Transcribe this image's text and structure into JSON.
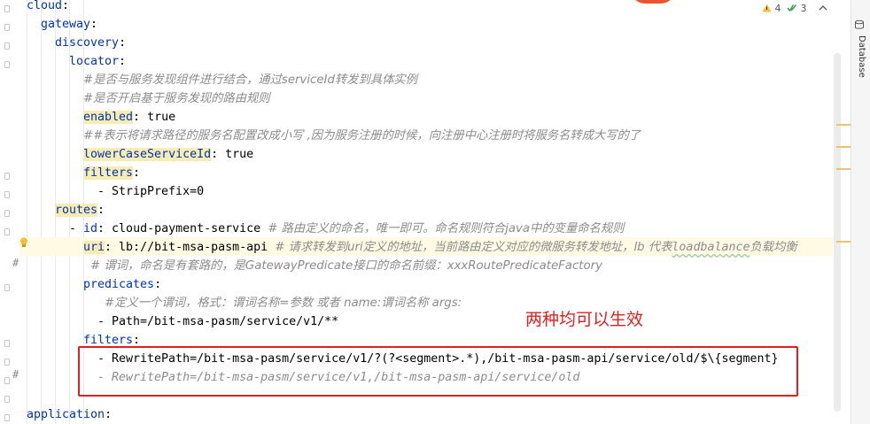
{
  "inspections": {
    "warnings": "4",
    "weak_warnings": "3",
    "warning_icon": "warning-triangle-icon",
    "check_icon": "double-check-icon",
    "up_icon": "chevron-up-icon",
    "down_icon": "chevron-down-icon"
  },
  "tool_window": {
    "label": "Database",
    "icon": "database-icon"
  },
  "annotation": {
    "text": "两种均可以生效",
    "color": "#e02020"
  },
  "gutter_marks": [
    "#",
    "#"
  ],
  "code": {
    "l1_key": "cloud",
    "l2_key": "gateway",
    "l3_key": "discovery",
    "l4_key": "locator",
    "l5_comment": "#是否与服务发现组件进行结合，通过serviceId转发到具体实例",
    "l6_comment": "#是否开启基于服务发现的路由规则",
    "l7_key": "enabled",
    "l7_value": "true",
    "l8_comment": "##表示将请求路径的服务名配置改成小写 ,因为服务注册的时候，向注册中心注册时将服务名转成大写的了",
    "l9_key": "lowerCaseServiceId",
    "l9_value": "true",
    "l10_key": "filters",
    "l11_item": "- StripPrefix=0",
    "l12_key": "routes",
    "l13_dash": "- ",
    "l13_key": "id",
    "l13_value": "cloud-payment-service",
    "l13_comment": "# 路由定义的命名，唯一即可。命名规则符合java中的变量命名规则",
    "l14_key": "uri",
    "l14_value": "lb://bit-msa-pasm-api",
    "l14_comment_a": "# 请求转发到uri定义的地址，当前路由定义对应的微服务转发地址，lb 代表",
    "l14_comment_b": "loadbalance",
    "l14_comment_c": "负载均衡",
    "l15_comment": "# 谓词，命名是有套路的，是GatewayPredicate接口的命名前缀：xxxRoutePredicateFactory",
    "l16_key": "predicates",
    "l17_comment": "#定义一个谓词，格式：谓词名称=参数 或者 name:谓词名称 args:",
    "l18_item": "- Path=/bit-msa-pasm/service/v1/**",
    "l19_key": "filters",
    "l20_item": "- RewritePath=/bit-msa-pasm/service/v1/?(?<segment>.*),/bit-msa-pasm-api/service/old/$\\{segment}",
    "l21_comment": "- RewritePath=/bit-msa-pasm/service/v1,/bit-msa-pasm-api/service/old",
    "l22_key": "application"
  }
}
